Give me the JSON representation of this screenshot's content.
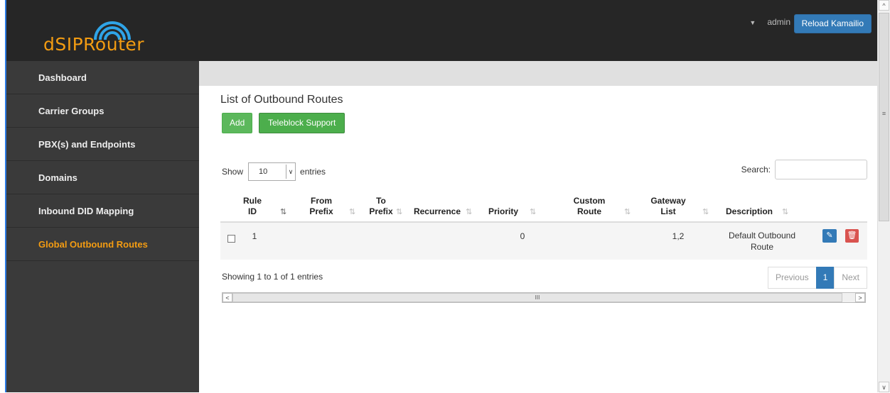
{
  "app": {
    "logo_text": "dSIPRouter",
    "user_label": "admin",
    "reload_button": "Reload Kamailio"
  },
  "sidebar": {
    "items": [
      {
        "label": "Dashboard",
        "active": false
      },
      {
        "label": "Carrier Groups",
        "active": false
      },
      {
        "label": "PBX(s) and Endpoints",
        "active": false
      },
      {
        "label": "Domains",
        "active": false
      },
      {
        "label": "Inbound DID Mapping",
        "active": false
      },
      {
        "label": "Global Outbound Routes",
        "active": true
      }
    ]
  },
  "main": {
    "title": "List of Outbound Routes",
    "add_button": "Add",
    "teleblock_button": "Teleblock Support",
    "show_label": "Show",
    "entries_select_value": "10",
    "entries_label": "entries",
    "search_label": "Search:",
    "search_value": "",
    "columns": {
      "rule_id_1": "Rule",
      "rule_id_2": "ID",
      "from_prefix_1": "From",
      "from_prefix_2": "Prefix",
      "to_prefix_1": "To",
      "to_prefix_2": "Prefix",
      "recurrence": "Recurrence",
      "priority": "Priority",
      "custom_route_1": "Custom",
      "custom_route_2": "Route",
      "gateway_list_1": "Gateway",
      "gateway_list_2": "List",
      "description": "Description"
    },
    "rows": [
      {
        "rule_id": "1",
        "from_prefix": "",
        "to_prefix": "",
        "recurrence": "",
        "priority": "0",
        "custom_route": "",
        "gateway_list": "1,2",
        "description_1": "Default Outbound",
        "description_2": "Route"
      }
    ],
    "showing_text": "Showing 1 to 1 of 1 entries",
    "pagination": {
      "previous": "Previous",
      "current": "1",
      "next": "Next"
    }
  },
  "colors": {
    "topbar": "#262626",
    "sidebar": "#3a3a3a",
    "accent_orange": "#f39c12",
    "primary_blue": "#337ab7",
    "success_green": "#5cb85c",
    "danger_red": "#d9534f"
  },
  "icons": {
    "sort_asc": "sort-ascending-icon",
    "sort_both": "sort-both-icon",
    "edit": "pencil-icon",
    "delete": "trash-icon"
  }
}
